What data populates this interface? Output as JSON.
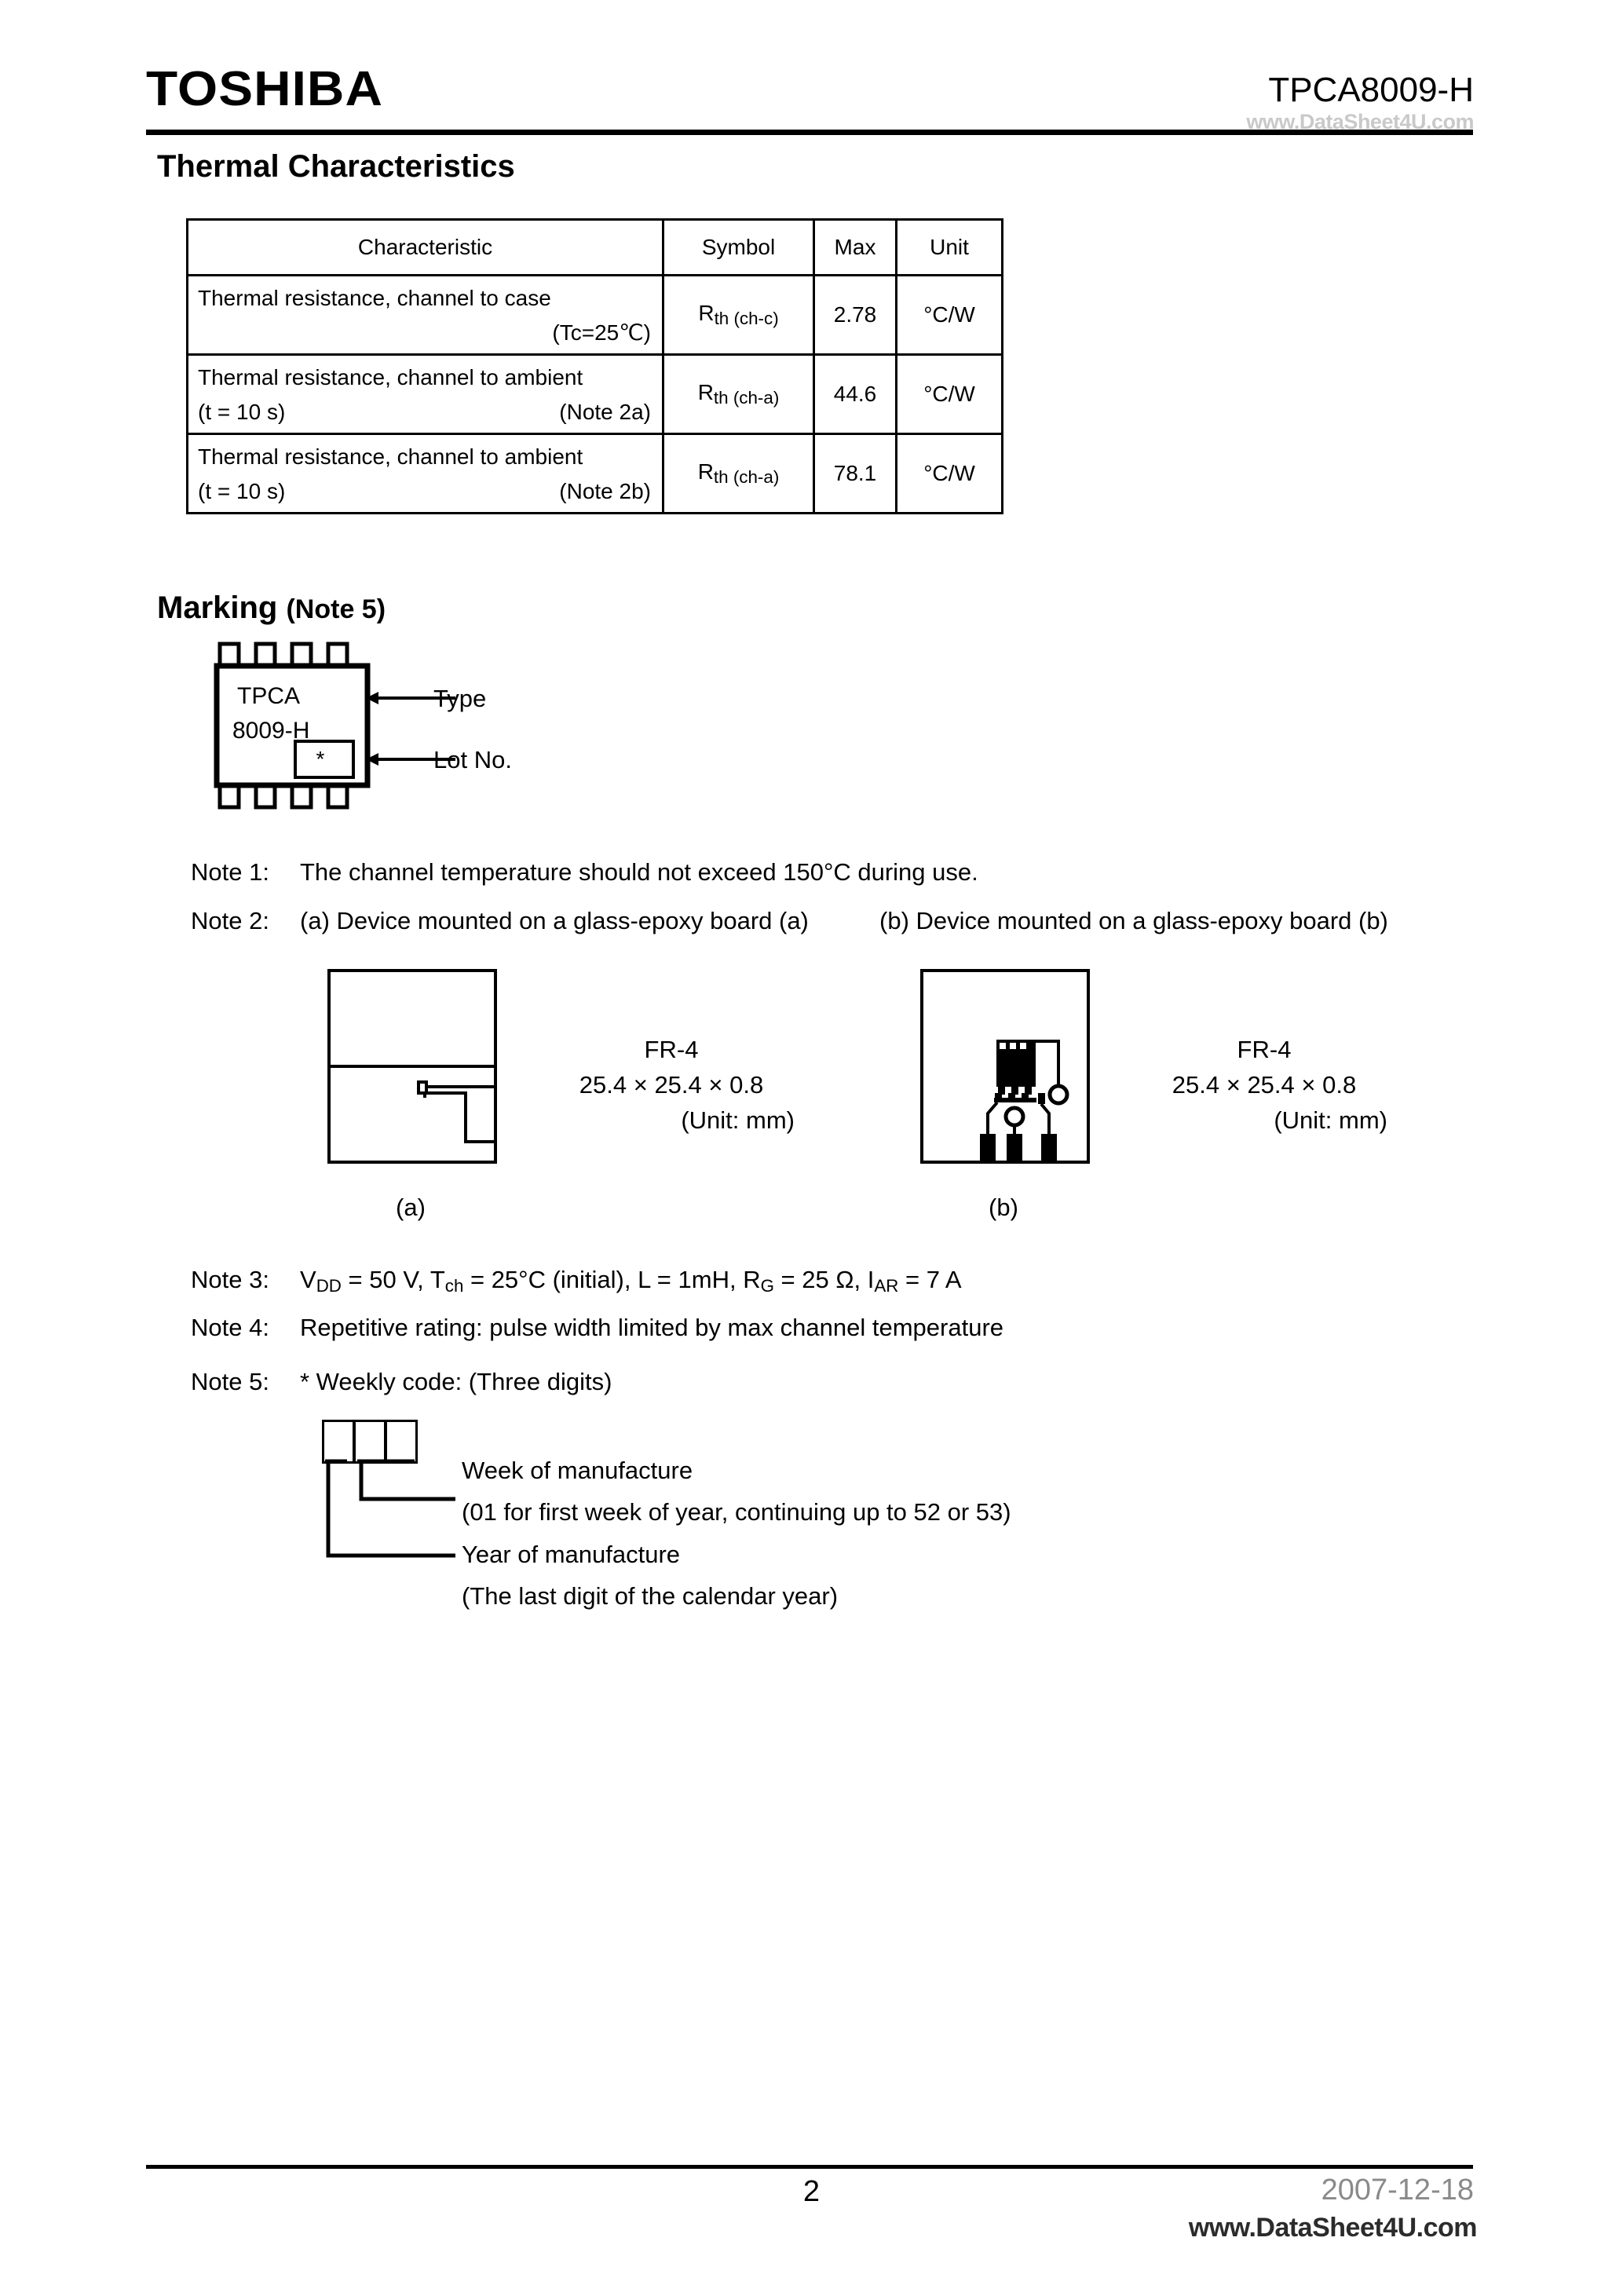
{
  "header": {
    "brand": "TOSHIBA",
    "part_number": "TPCA8009-H",
    "watermark": "www.DataSheet4U.com"
  },
  "sections": {
    "thermal_heading": "Thermal Characteristics",
    "marking_heading": "Marking",
    "marking_heading_note": "(Note 5)"
  },
  "thermal_table": {
    "columns": [
      "Characteristic",
      "Symbol",
      "Max",
      "Unit"
    ],
    "rows": [
      {
        "characteristic_line1": "Thermal resistance, channel to case",
        "characteristic_line2_right": "(Tc=25℃)",
        "characteristic_line2_left": "",
        "symbol_main": "R",
        "symbol_sub": "th (ch-c)",
        "max": "2.78",
        "unit": "°C/W"
      },
      {
        "characteristic_line1": "Thermal resistance, channel to ambient",
        "characteristic_line2_right": "(Note 2a)",
        "characteristic_line2_left": "(t = 10 s)",
        "symbol_main": "R",
        "symbol_sub": "th (ch-a)",
        "max": "44.6",
        "unit": "°C/W"
      },
      {
        "characteristic_line1": "Thermal resistance, channel to ambient",
        "characteristic_line2_right": "(Note 2b)",
        "characteristic_line2_left": "(t = 10 s)",
        "symbol_main": "R",
        "symbol_sub": "th (ch-a)",
        "max": "78.1",
        "unit": "°C/W"
      }
    ]
  },
  "marking": {
    "package_line1": "TPCA",
    "package_line2": "8009-H",
    "lot_mark": "*",
    "callout_type": "Type",
    "callout_lot": "Lot No."
  },
  "notes": {
    "note1_label": "Note 1:",
    "note1_text": "The channel temperature should not exceed 150°C during use.",
    "note2_label": "Note 2:",
    "note2a_text": "(a) Device mounted on a glass-epoxy board (a)",
    "note2b_text": "(b) Device mounted on a glass-epoxy board (b)",
    "note3_label": "Note 3:",
    "note4_label": "Note 4:",
    "note4_text": "Repetitive rating: pulse width limited by max channel temperature",
    "note5_label": "Note 5:",
    "note5_text": "* Weekly code:  (Three digits)"
  },
  "note3": {
    "vdd_main": "V",
    "vdd_sub": "DD",
    "vdd_val": " = 50 V, ",
    "tch_main": "T",
    "tch_sub": "ch",
    "tch_val": " = 25°C (initial), L = 1mH, ",
    "rg_main": "R",
    "rg_sub": "G",
    "rg_val": " = 25 Ω, ",
    "iar_main": "I",
    "iar_sub": "AR",
    "iar_val": " = 7 A"
  },
  "boards": {
    "a": {
      "caption": "(a)",
      "material": "FR-4",
      "dimensions": "25.4 × 25.4 × 0.8",
      "unit_note": "(Unit: mm)"
    },
    "b": {
      "caption": "(b)",
      "material": "FR-4",
      "dimensions": "25.4 × 25.4 × 0.8",
      "unit_note": "(Unit: mm)"
    }
  },
  "weekly_code": {
    "week_label": "Week of manufacture",
    "week_detail": "(01 for first week of year, continuing up to 52 or 53)",
    "year_label": "Year of manufacture",
    "year_detail": "(The last digit of the calendar year)"
  },
  "footer": {
    "page_number": "2",
    "date": "2007-12-18",
    "watermark": "www.DataSheet4U.com"
  }
}
